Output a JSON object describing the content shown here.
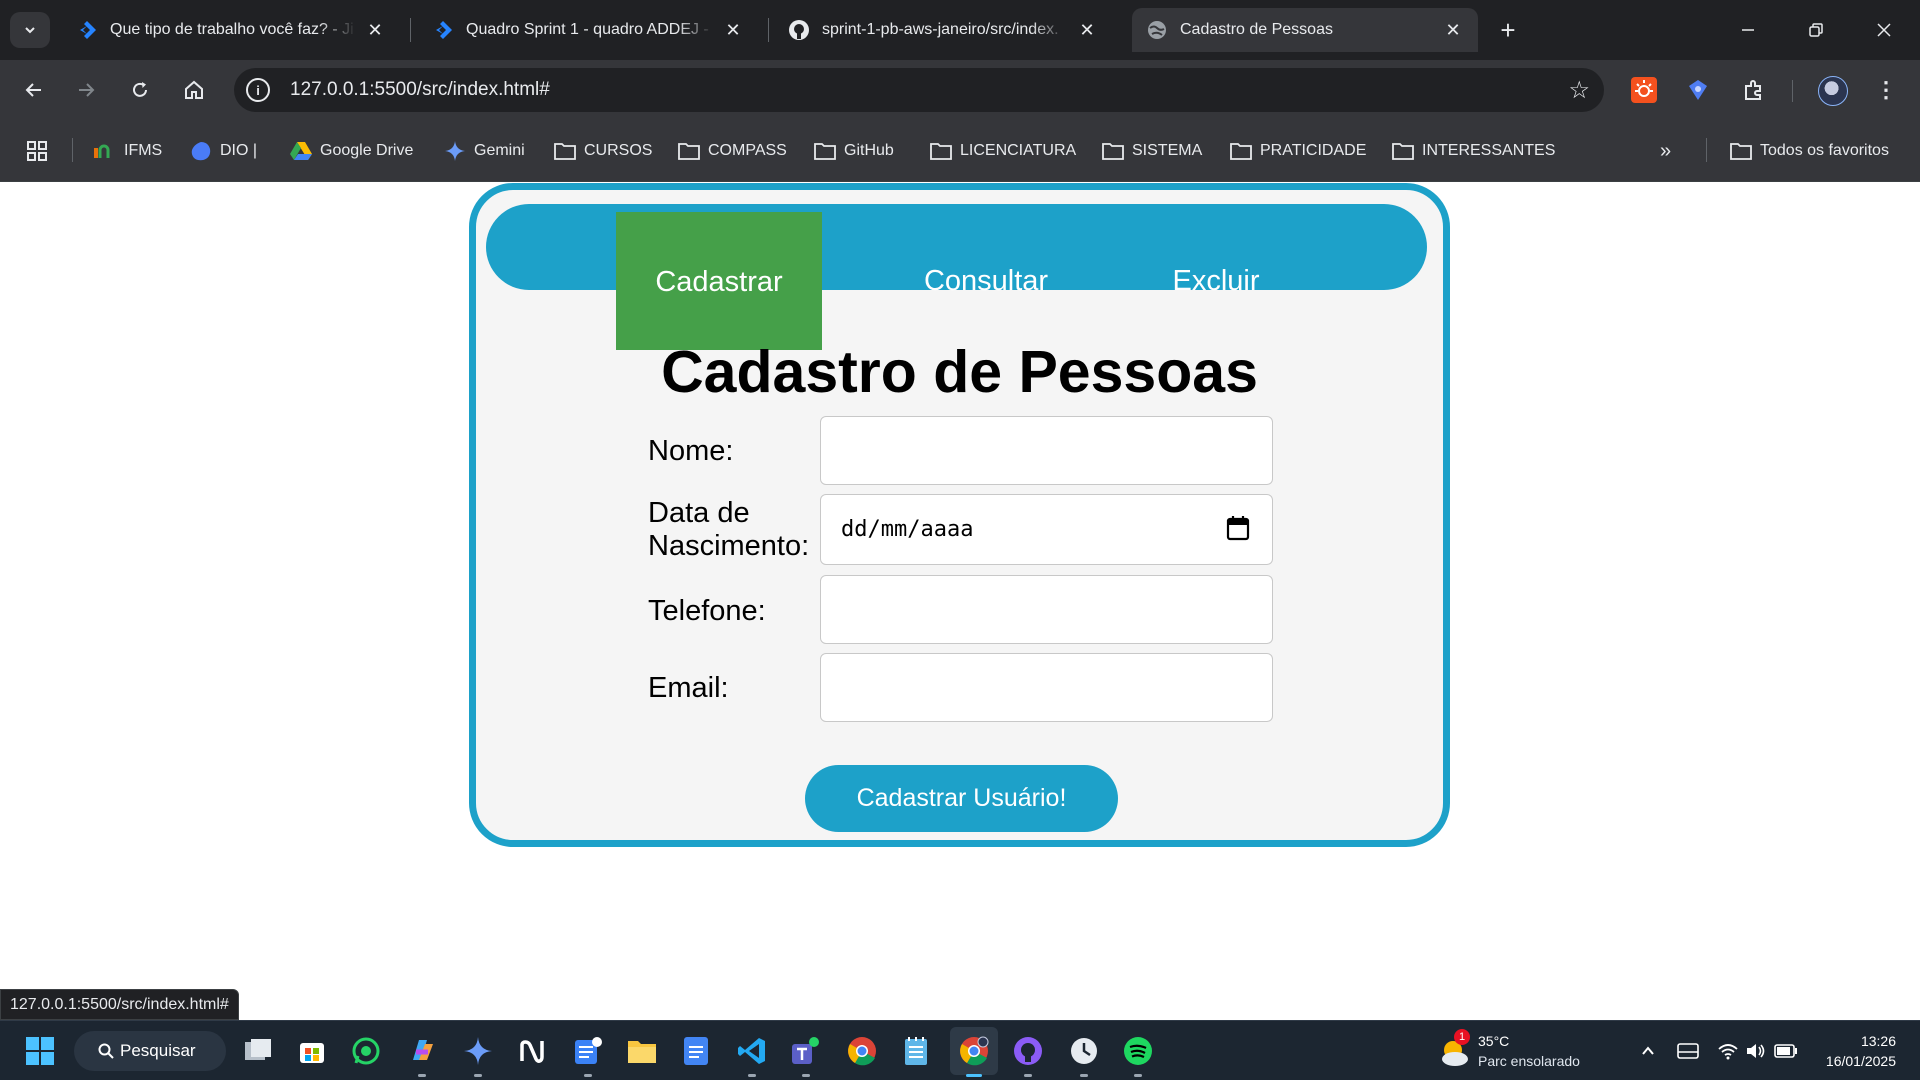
{
  "browser": {
    "tabs": [
      {
        "title": "Que tipo de trabalho você faz? - Ji",
        "icon": "jira-icon"
      },
      {
        "title": "Quadro Sprint 1 - quadro ADDEJ -",
        "icon": "jira-icon"
      },
      {
        "title": "sprint-1-pb-aws-janeiro/src/index.",
        "icon": "github-icon"
      },
      {
        "title": "Cadastro de Pessoas",
        "icon": "globe-icon"
      }
    ],
    "address_url": "127.0.0.1:5500/src/index.html#",
    "status_url": "127.0.0.1:5500/src/index.html#",
    "bookmarks": [
      {
        "label": "IFMS",
        "icon": "ifms-icon"
      },
      {
        "label": "DIO |",
        "icon": "dio-icon"
      },
      {
        "label": "Google Drive",
        "icon": "google-drive-icon"
      },
      {
        "label": "Gemini",
        "icon": "gemini-icon"
      },
      {
        "label": "CURSOS",
        "icon": "folder-icon"
      },
      {
        "label": "COMPASS",
        "icon": "folder-icon"
      },
      {
        "label": "GitHub",
        "icon": "folder-icon"
      },
      {
        "label": "LICENCIATURA",
        "icon": "folder-icon"
      },
      {
        "label": "SISTEMA",
        "icon": "folder-icon"
      },
      {
        "label": "PRATICIDADE",
        "icon": "folder-icon"
      },
      {
        "label": "INTERESSANTES",
        "icon": "folder-icon"
      }
    ],
    "all_bookmarks_label": "Todos os favoritos"
  },
  "app": {
    "nav": [
      {
        "label": "Cadastrar",
        "active": true
      },
      {
        "label": "Consultar",
        "active": false
      },
      {
        "label": "Excluir",
        "active": false
      }
    ],
    "title": "Cadastro de Pessoas",
    "fields": {
      "nome": {
        "label": "Nome:",
        "value": ""
      },
      "nascimento": {
        "label_line1": "Data de",
        "label_line2": "Nascimento:",
        "placeholder": "dd/mm/aaaa"
      },
      "telefone": {
        "label": "Telefone:",
        "value": ""
      },
      "email": {
        "label": "Email:",
        "value": ""
      }
    },
    "submit_label": "Cadastrar Usuário!",
    "colors": {
      "primary": "#1da1c9",
      "active_tab": "#45a049",
      "card_bg": "#f5f5f5"
    }
  },
  "taskbar": {
    "search_label": "Pesquisar",
    "weather": {
      "temp": "35°C",
      "desc": "Parc ensolarado",
      "badge": "1"
    },
    "time": "13:26",
    "date": "16/01/2025"
  }
}
